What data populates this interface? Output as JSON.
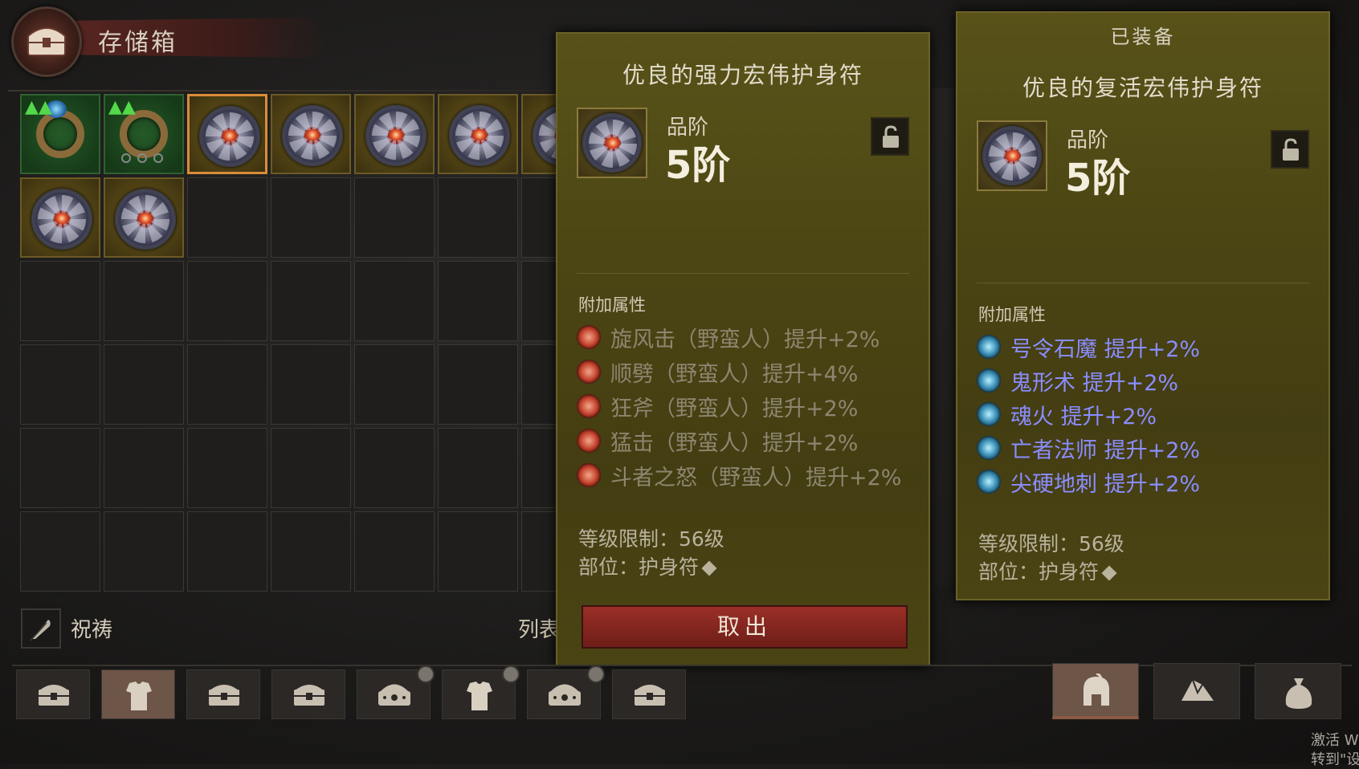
{
  "header": {
    "title": "存储箱",
    "emblem_icon": "chest-icon"
  },
  "grid": {
    "cols": 7,
    "rows": 6,
    "items": [
      {
        "type": "ring-blue",
        "upgrade": true,
        "icon": "ring-icon"
      },
      {
        "type": "ring-sockets",
        "upgrade": true,
        "icon": "ring-icon"
      },
      {
        "type": "amulet",
        "selected": true,
        "icon": "amulet-icon"
      },
      {
        "type": "amulet",
        "icon": "amulet-icon"
      },
      {
        "type": "amulet",
        "icon": "amulet-icon"
      },
      {
        "type": "amulet",
        "icon": "amulet-icon"
      },
      {
        "type": "amulet",
        "icon": "amulet-icon"
      },
      {
        "type": "amulet",
        "icon": "amulet-icon"
      },
      {
        "type": "amulet",
        "icon": "amulet-icon"
      }
    ]
  },
  "bottom_left": {
    "pray_label": "祝祷",
    "pray_icon": "feather-icon",
    "list_label": "列表"
  },
  "tooltip_selected": {
    "title": "优良的强力宏伟护身符",
    "grade_label": "品阶",
    "grade_value": "5阶",
    "lock_icon": "lock-open-icon",
    "attr_heading": "附加属性",
    "attributes": [
      "旋风击（野蛮人）提升+2%",
      "顺劈（野蛮人）提升+4%",
      "狂斧（野蛮人）提升+2%",
      "猛击（野蛮人）提升+2%",
      "斗者之怒（野蛮人）提升+2%"
    ],
    "level_req": "等级限制：56级",
    "slot": "部位：护身符",
    "take_button": "取出"
  },
  "tooltip_equipped": {
    "equipped_label": "已装备",
    "title": "优良的复活宏伟护身符",
    "grade_label": "品阶",
    "grade_value": "5阶",
    "lock_icon": "lock-open-icon",
    "attr_heading": "附加属性",
    "attributes": [
      "号令石魔 提升+2%",
      "鬼形术 提升+2%",
      "魂火 提升+2%",
      "亡者法师 提升+2%",
      "尖硬地刺 提升+2%"
    ],
    "level_req": "等级限制：56级",
    "slot": "部位：护身符"
  },
  "bottom_tabs": [
    {
      "icon": "chest-icon",
      "active": false,
      "timer": false
    },
    {
      "icon": "armor-icon",
      "active": true,
      "timer": false
    },
    {
      "icon": "chest-icon",
      "active": false,
      "timer": false
    },
    {
      "icon": "chest-icon",
      "active": false,
      "timer": false
    },
    {
      "icon": "ornate-chest-icon",
      "active": false,
      "timer": true
    },
    {
      "icon": "armor-icon",
      "active": false,
      "timer": true
    },
    {
      "icon": "ornate-chest-icon",
      "active": false,
      "timer": true
    },
    {
      "icon": "chest-icon",
      "active": false,
      "timer": false
    }
  ],
  "right_tabs": [
    {
      "icon": "helmet-icon",
      "active": true
    },
    {
      "icon": "gem-pile-icon",
      "active": false
    },
    {
      "icon": "gold-bag-icon",
      "active": false
    }
  ],
  "watermark": {
    "line1": "激活 W",
    "line2": "转到\"设置"
  },
  "colors": {
    "accent_orange": "#d98c3a",
    "upgrade_green": "#53d84a",
    "magic_blue": "#8a8dff",
    "panel_gold": "#4c4614",
    "button_red": "#8a2a22"
  }
}
